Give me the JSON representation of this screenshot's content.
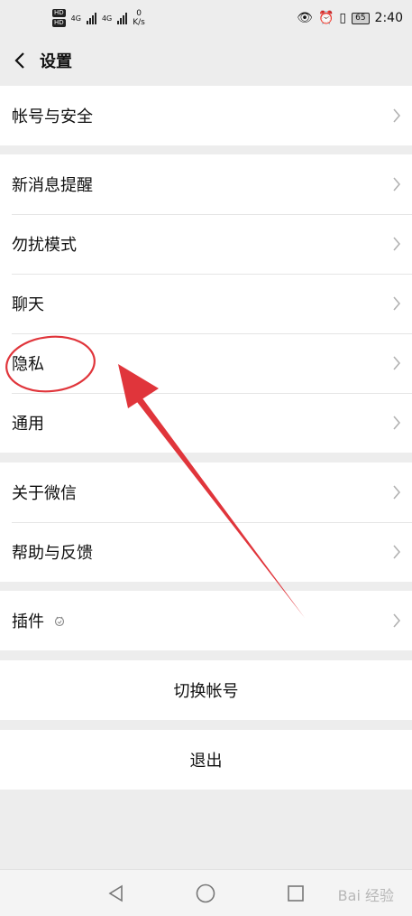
{
  "status_bar": {
    "hd_badge": "HD",
    "network_1": "4G",
    "network_2": "4G",
    "speed_value": "0",
    "speed_unit": "K/s",
    "battery": "65",
    "time": "2:40"
  },
  "header": {
    "title": "设置"
  },
  "groups": [
    {
      "items": [
        {
          "label": "帐号与安全"
        }
      ]
    },
    {
      "items": [
        {
          "label": "新消息提醒"
        },
        {
          "label": "勿扰模式"
        },
        {
          "label": "聊天"
        },
        {
          "label": "隐私"
        },
        {
          "label": "通用"
        }
      ]
    },
    {
      "items": [
        {
          "label": "关于微信"
        },
        {
          "label": "帮助与反馈"
        }
      ]
    },
    {
      "items": [
        {
          "label": "插件"
        }
      ]
    }
  ],
  "switch_account": "切换帐号",
  "logout": "退出",
  "watermark": "Bai 经验"
}
